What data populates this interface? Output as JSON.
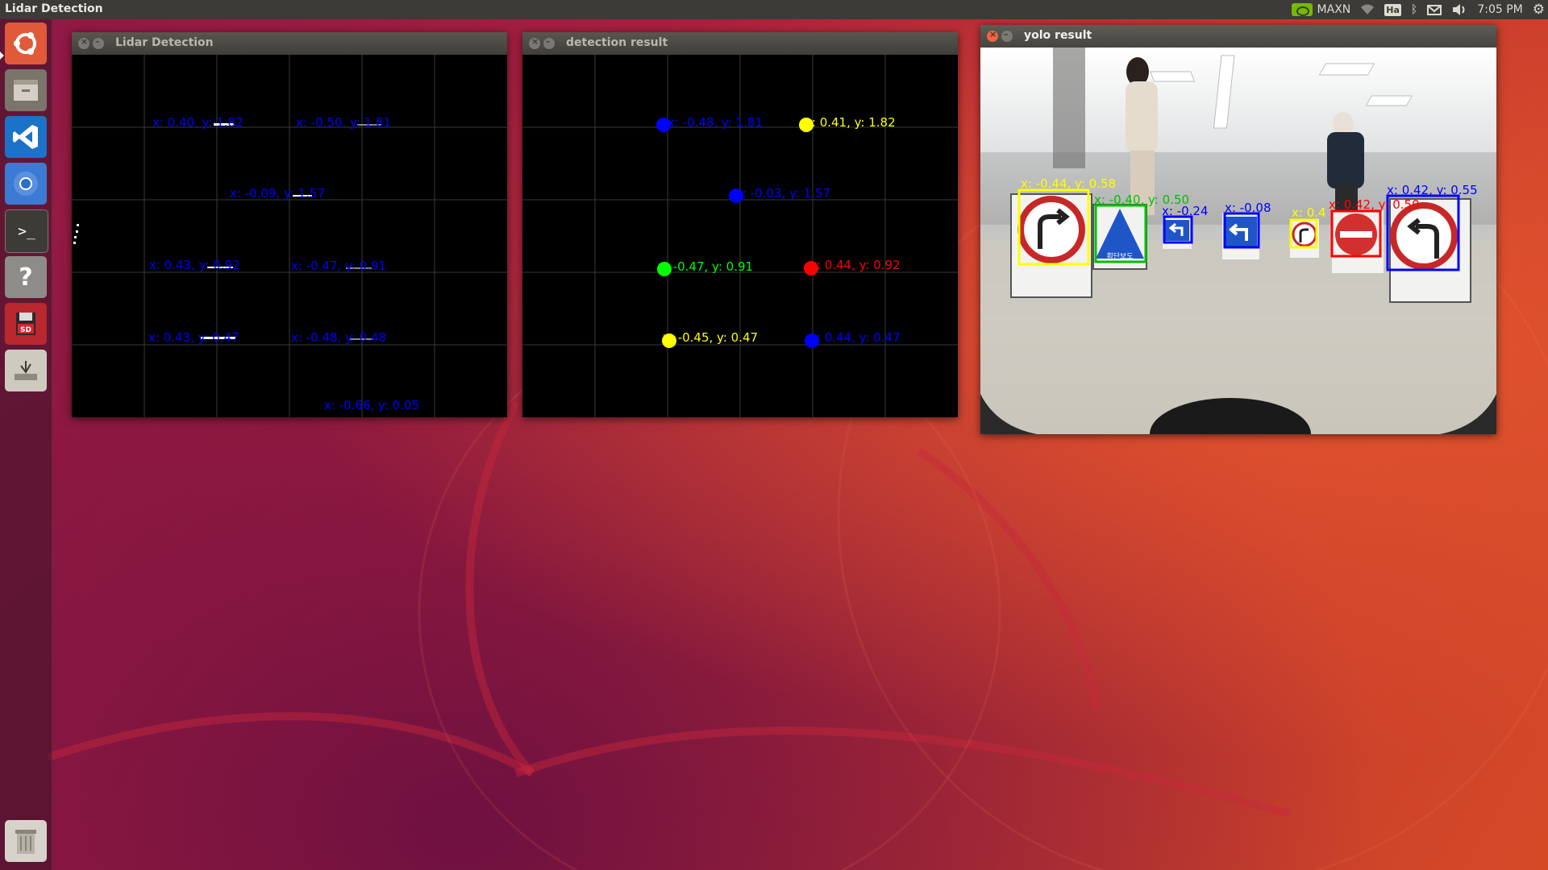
{
  "panel": {
    "app_title": "Lidar Detection",
    "status": "MAXN",
    "keyboard": "Ha",
    "clock": "7:05 PM"
  },
  "launcher": [
    {
      "name": "ubuntu-dash-icon",
      "glyph": "◎"
    },
    {
      "name": "files-icon",
      "glyph": "▭"
    },
    {
      "name": "vscode-icon",
      "glyph": "⋊"
    },
    {
      "name": "chromium-icon",
      "glyph": "◯"
    },
    {
      "name": "terminal-icon",
      "glyph": ">_"
    },
    {
      "name": "help-icon",
      "glyph": "?"
    },
    {
      "name": "sd-card-icon",
      "glyph": "SD"
    },
    {
      "name": "usb-drive-icon",
      "glyph": "⏚"
    },
    {
      "name": "trash-icon",
      "glyph": "🗑"
    }
  ],
  "windows": {
    "lidar": {
      "title": "Lidar Detection",
      "labels": [
        "x: 0.40, y: 1.82",
        "x: -0.50, y: 1.81",
        "x: -0.09, y: 1.57",
        "x: 0.43, y: 0.92",
        "x: -0.47, y: 0.91",
        "x: 0.43, y: 0.47",
        "x: -0.48, y: 0.48",
        "x: -0.66, y: 0.05"
      ]
    },
    "detection": {
      "title": "detection result",
      "labels": [
        "x: -0.48, y: 1.81",
        "x: 0.41, y: 1.82",
        "x: -0.03, y: 1.57",
        "x: -0.47, y: 0.91",
        "x: 0.44, y: 0.92",
        "x: -0.45, y: 0.47",
        "x: 0.44, y: 0.47"
      ],
      "colors": {
        "blue": "#0000ff",
        "yellow": "#ffff00",
        "green": "#00ff00",
        "red": "#ff0000"
      }
    },
    "yolo": {
      "title": "yolo result",
      "box_labels": [
        "x: -0.44, y: 0.58",
        "x: -0.40, y: 0.50",
        "x: -0.24",
        "x: -0.08",
        "x: 0.4",
        "x: 0.42, y: 0.50",
        "x: 0.42, y: 0.55"
      ],
      "crosswalk_sign_text": "횡단보도"
    }
  }
}
